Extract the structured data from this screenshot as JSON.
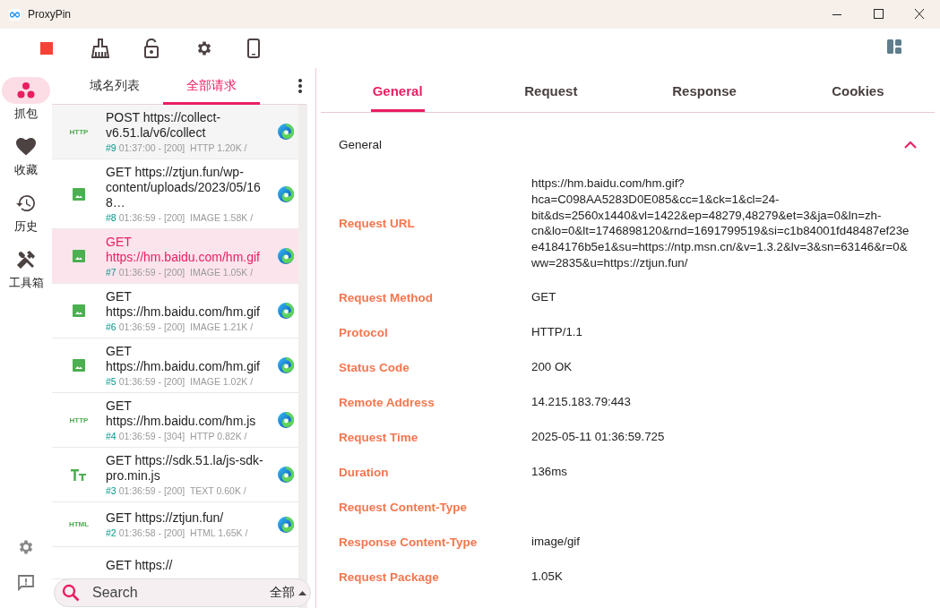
{
  "window": {
    "title": "ProxyPin"
  },
  "nav": {
    "items": [
      {
        "label": "抓包",
        "kind": "capture",
        "selected": true
      },
      {
        "label": "收藏",
        "kind": "favorites",
        "selected": false
      },
      {
        "label": "历史",
        "kind": "history",
        "selected": false
      },
      {
        "label": "工具箱",
        "kind": "tools",
        "selected": false
      }
    ]
  },
  "list_tabs": [
    {
      "label": "域名列表",
      "selected": false
    },
    {
      "label": "全部请求",
      "selected": true
    }
  ],
  "requests": [
    {
      "kind": "http",
      "badge": "HTTP",
      "title": "POST https://collect-v6.51.la/v6/collect",
      "number": "#9",
      "meta": "01:37:00 - [200]  HTTP 1.20K /",
      "selected": false
    },
    {
      "kind": "image",
      "title": "GET https://ztjun.fun/wp-content/uploads/2023/05/168…",
      "number": "#8",
      "meta": "01:36:59 - [200]  IMAGE 1.58K /",
      "selected": false
    },
    {
      "kind": "image",
      "title": "GET https://hm.baidu.com/hm.gif",
      "number": "#7",
      "meta": "01:36:59 - [200]  IMAGE 1.05K /",
      "selected": true
    },
    {
      "kind": "image",
      "title": "GET https://hm.baidu.com/hm.gif",
      "number": "#6",
      "meta": "01:36:59 - [200]  IMAGE 1.21K /",
      "selected": false
    },
    {
      "kind": "image",
      "title": "GET https://hm.baidu.com/hm.gif",
      "number": "#5",
      "meta": "01:36:59 - [200]  IMAGE 1.02K /",
      "selected": false
    },
    {
      "kind": "http",
      "badge": "HTTP",
      "title": "GET https://hm.baidu.com/hm.js",
      "number": "#4",
      "meta": "01:36:59 - [304]  HTTP 0.82K /",
      "selected": false
    },
    {
      "kind": "text",
      "title": "GET https://sdk.51.la/js-sdk-pro.min.js",
      "number": "#3",
      "meta": "01:36:59 - [200]  TEXT 0.60K /",
      "selected": false
    },
    {
      "kind": "html",
      "badge": "HTML",
      "title": "GET https://ztjun.fun/",
      "number": "#2",
      "meta": "01:36:58 - [200]  HTML 1.65K /",
      "selected": false
    },
    {
      "kind": "partial",
      "title": "GET https://"
    }
  ],
  "search": {
    "placeholder": "Search",
    "filter": "全部"
  },
  "detail_tabs": [
    {
      "label": "General",
      "selected": true
    },
    {
      "label": "Request",
      "selected": false
    },
    {
      "label": "Response",
      "selected": false
    },
    {
      "label": "Cookies",
      "selected": false
    }
  ],
  "section": {
    "title": "General",
    "expanded": true
  },
  "fields": [
    {
      "label": "Request URL",
      "value": "https://hm.baidu.com/hm.gif?hca=C098AA5283D0E085&cc=1&ck=1&cl=24-bit&ds=2560x1440&vl=1422&ep=48279,48279&et=3&ja=0&ln=zh-cn&lo=0&lt=1746898120&rnd=1691799519&si=c1b84001fd48487ef23ee4184176b5e1&su=https://ntp.msn.cn/&v=1.3.2&lv=3&sn=63146&r=0&ww=2835&u=https://ztjun.fun/"
    },
    {
      "label": "Request Method",
      "value": "GET"
    },
    {
      "label": "Protocol",
      "value": "HTTP/1.1"
    },
    {
      "label": "Status Code",
      "value": "200  OK"
    },
    {
      "label": "Remote Address",
      "value": "14.215.183.79:443"
    },
    {
      "label": "Request Time",
      "value": "2025-05-11 01:36:59.725"
    },
    {
      "label": "Duration",
      "value": "136ms"
    },
    {
      "label": "Request Content-Type"
    },
    {
      "label": "Response Content-Type",
      "value": "image/gif"
    },
    {
      "label": "Request Package",
      "value": "1.05K"
    }
  ]
}
